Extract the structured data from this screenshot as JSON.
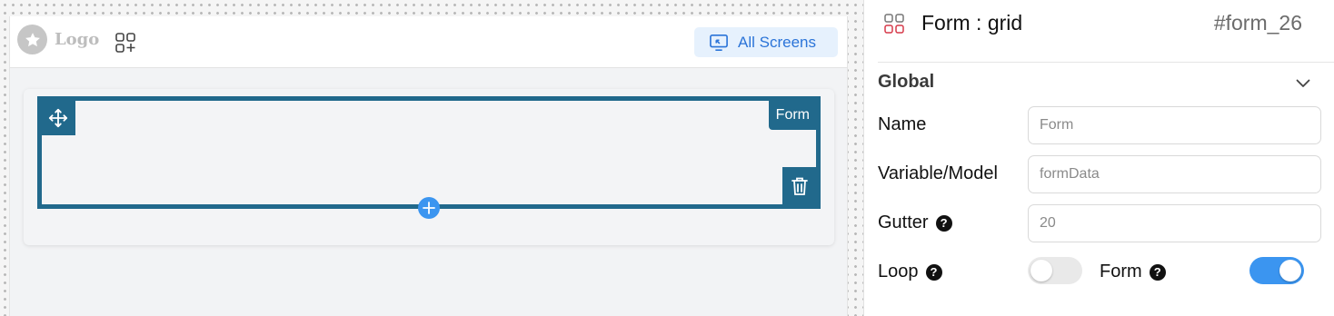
{
  "canvas": {
    "logo_text": "Logo",
    "all_screens_label": "All Screens",
    "form_tag": "Form"
  },
  "panel": {
    "title": "Form : grid",
    "element_id": "#form_26",
    "section": "Global",
    "fields": {
      "name": {
        "label": "Name",
        "placeholder": "Form",
        "value": ""
      },
      "model": {
        "label": "Variable/Model",
        "placeholder": "formData",
        "value": ""
      },
      "gutter": {
        "label": "Gutter",
        "placeholder": "20",
        "value": ""
      }
    },
    "toggles": {
      "loop": {
        "label": "Loop",
        "on": false
      },
      "form": {
        "label": "Form",
        "on": true
      }
    }
  },
  "colors": {
    "form_border": "#21698c",
    "accent": "#3b95f0",
    "all_screens_bg": "#e6f1fd",
    "all_screens_text": "#2b74d8"
  },
  "icons": [
    "star-icon",
    "add-widget-icon",
    "screens-icon",
    "move-icon",
    "delete-icon",
    "plus-icon",
    "grid-icon",
    "chevron-down-icon",
    "help-icon"
  ]
}
